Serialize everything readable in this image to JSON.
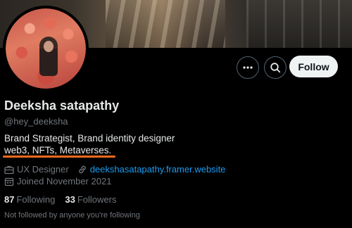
{
  "profile": {
    "name": "Deeksha satapathy",
    "handle": "@hey_deeksha",
    "bio_line1": "Brand Strategist, Brand identity designer",
    "bio_line2": "web3, NFTs, Metaverses.",
    "job": "UX Designer",
    "website": "deekshasatapathy.framer.website",
    "joined": "Joined November 2021",
    "following_count": "87",
    "following_label": "Following",
    "followers_count": "33",
    "followers_label": "Followers",
    "mutuals_note": "Not followed by anyone you're following"
  },
  "actions": {
    "follow_label": "Follow",
    "more_icon": "more-icon",
    "search_icon": "search-icon"
  },
  "colors": {
    "accent_link": "#1d9bf0",
    "underline_annotation": "#f26a1b",
    "muted_text": "#71767b"
  }
}
